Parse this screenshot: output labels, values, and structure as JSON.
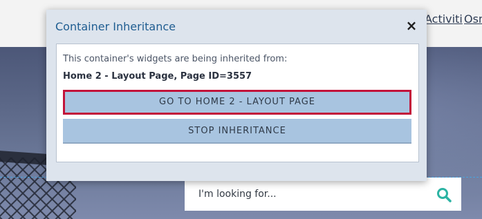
{
  "header": {
    "nav_items": [
      "Activiti",
      "Osm"
    ]
  },
  "search": {
    "placeholder": "I'm looking for..."
  },
  "modal": {
    "title": "Container Inheritance",
    "close_label": "×",
    "description": "This container's widgets are being inherited from:",
    "source": "Home 2 - Layout Page, Page ID=3557",
    "goto_button_label": "GO TO HOME 2 - LAYOUT PAGE",
    "stop_button_label": "STOP INHERITANCE"
  },
  "colors": {
    "modal_title": "#1f5d91",
    "button_bg": "#a8c4e0",
    "focus_outline": "#c2133a",
    "search_icon": "#2bb3a3"
  },
  "icons": {
    "search": "search-icon",
    "close": "close-icon"
  }
}
